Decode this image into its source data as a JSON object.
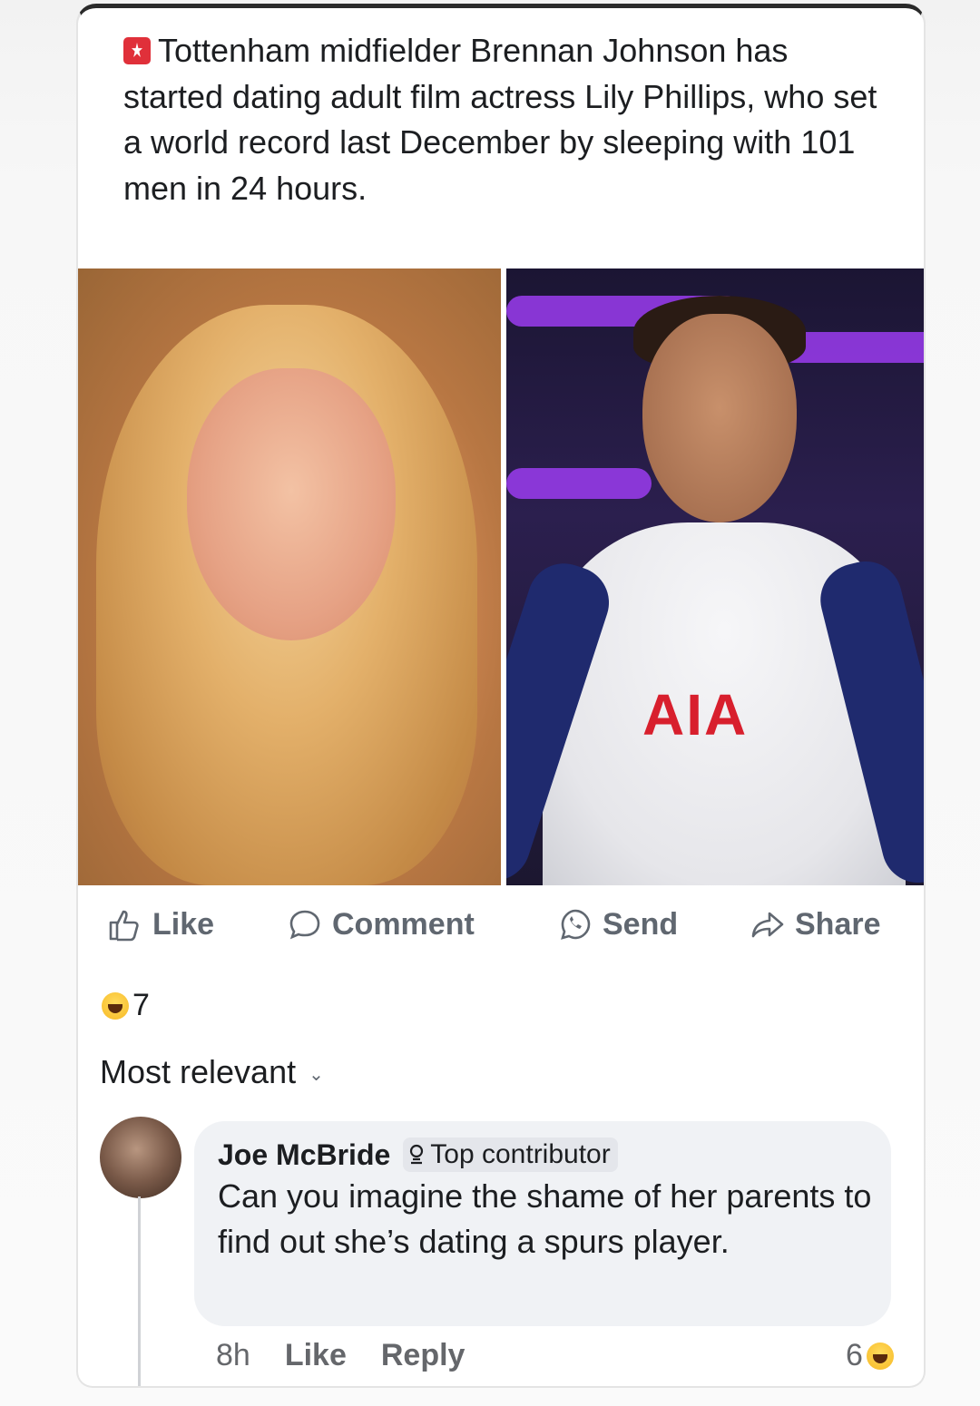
{
  "post": {
    "text": "Tottenham midfielder Brennan Johnson has started dating adult film actress Lily Phillips, who set a world record last December by sleeping with 101 men in 24 hours.",
    "sponsor_text": "AIA"
  },
  "actions": {
    "like": "Like",
    "comment": "Comment",
    "send": "Send",
    "share": "Share"
  },
  "reactions": {
    "count": "7",
    "icon": "haha-emoji"
  },
  "comments_sort": {
    "label": "Most relevant"
  },
  "comment": {
    "author": "Joe McBride",
    "badge": "Top contributor",
    "text": "Can you imagine the shame of her parents to find out she’s dating a spurs player.",
    "time": "8h",
    "like": "Like",
    "reply": "Reply",
    "reaction_count": "6"
  },
  "colors": {
    "accent_red": "#d81f2d",
    "text": "#1c1e21",
    "muted": "#65676b",
    "bubble": "#f0f2f5"
  }
}
